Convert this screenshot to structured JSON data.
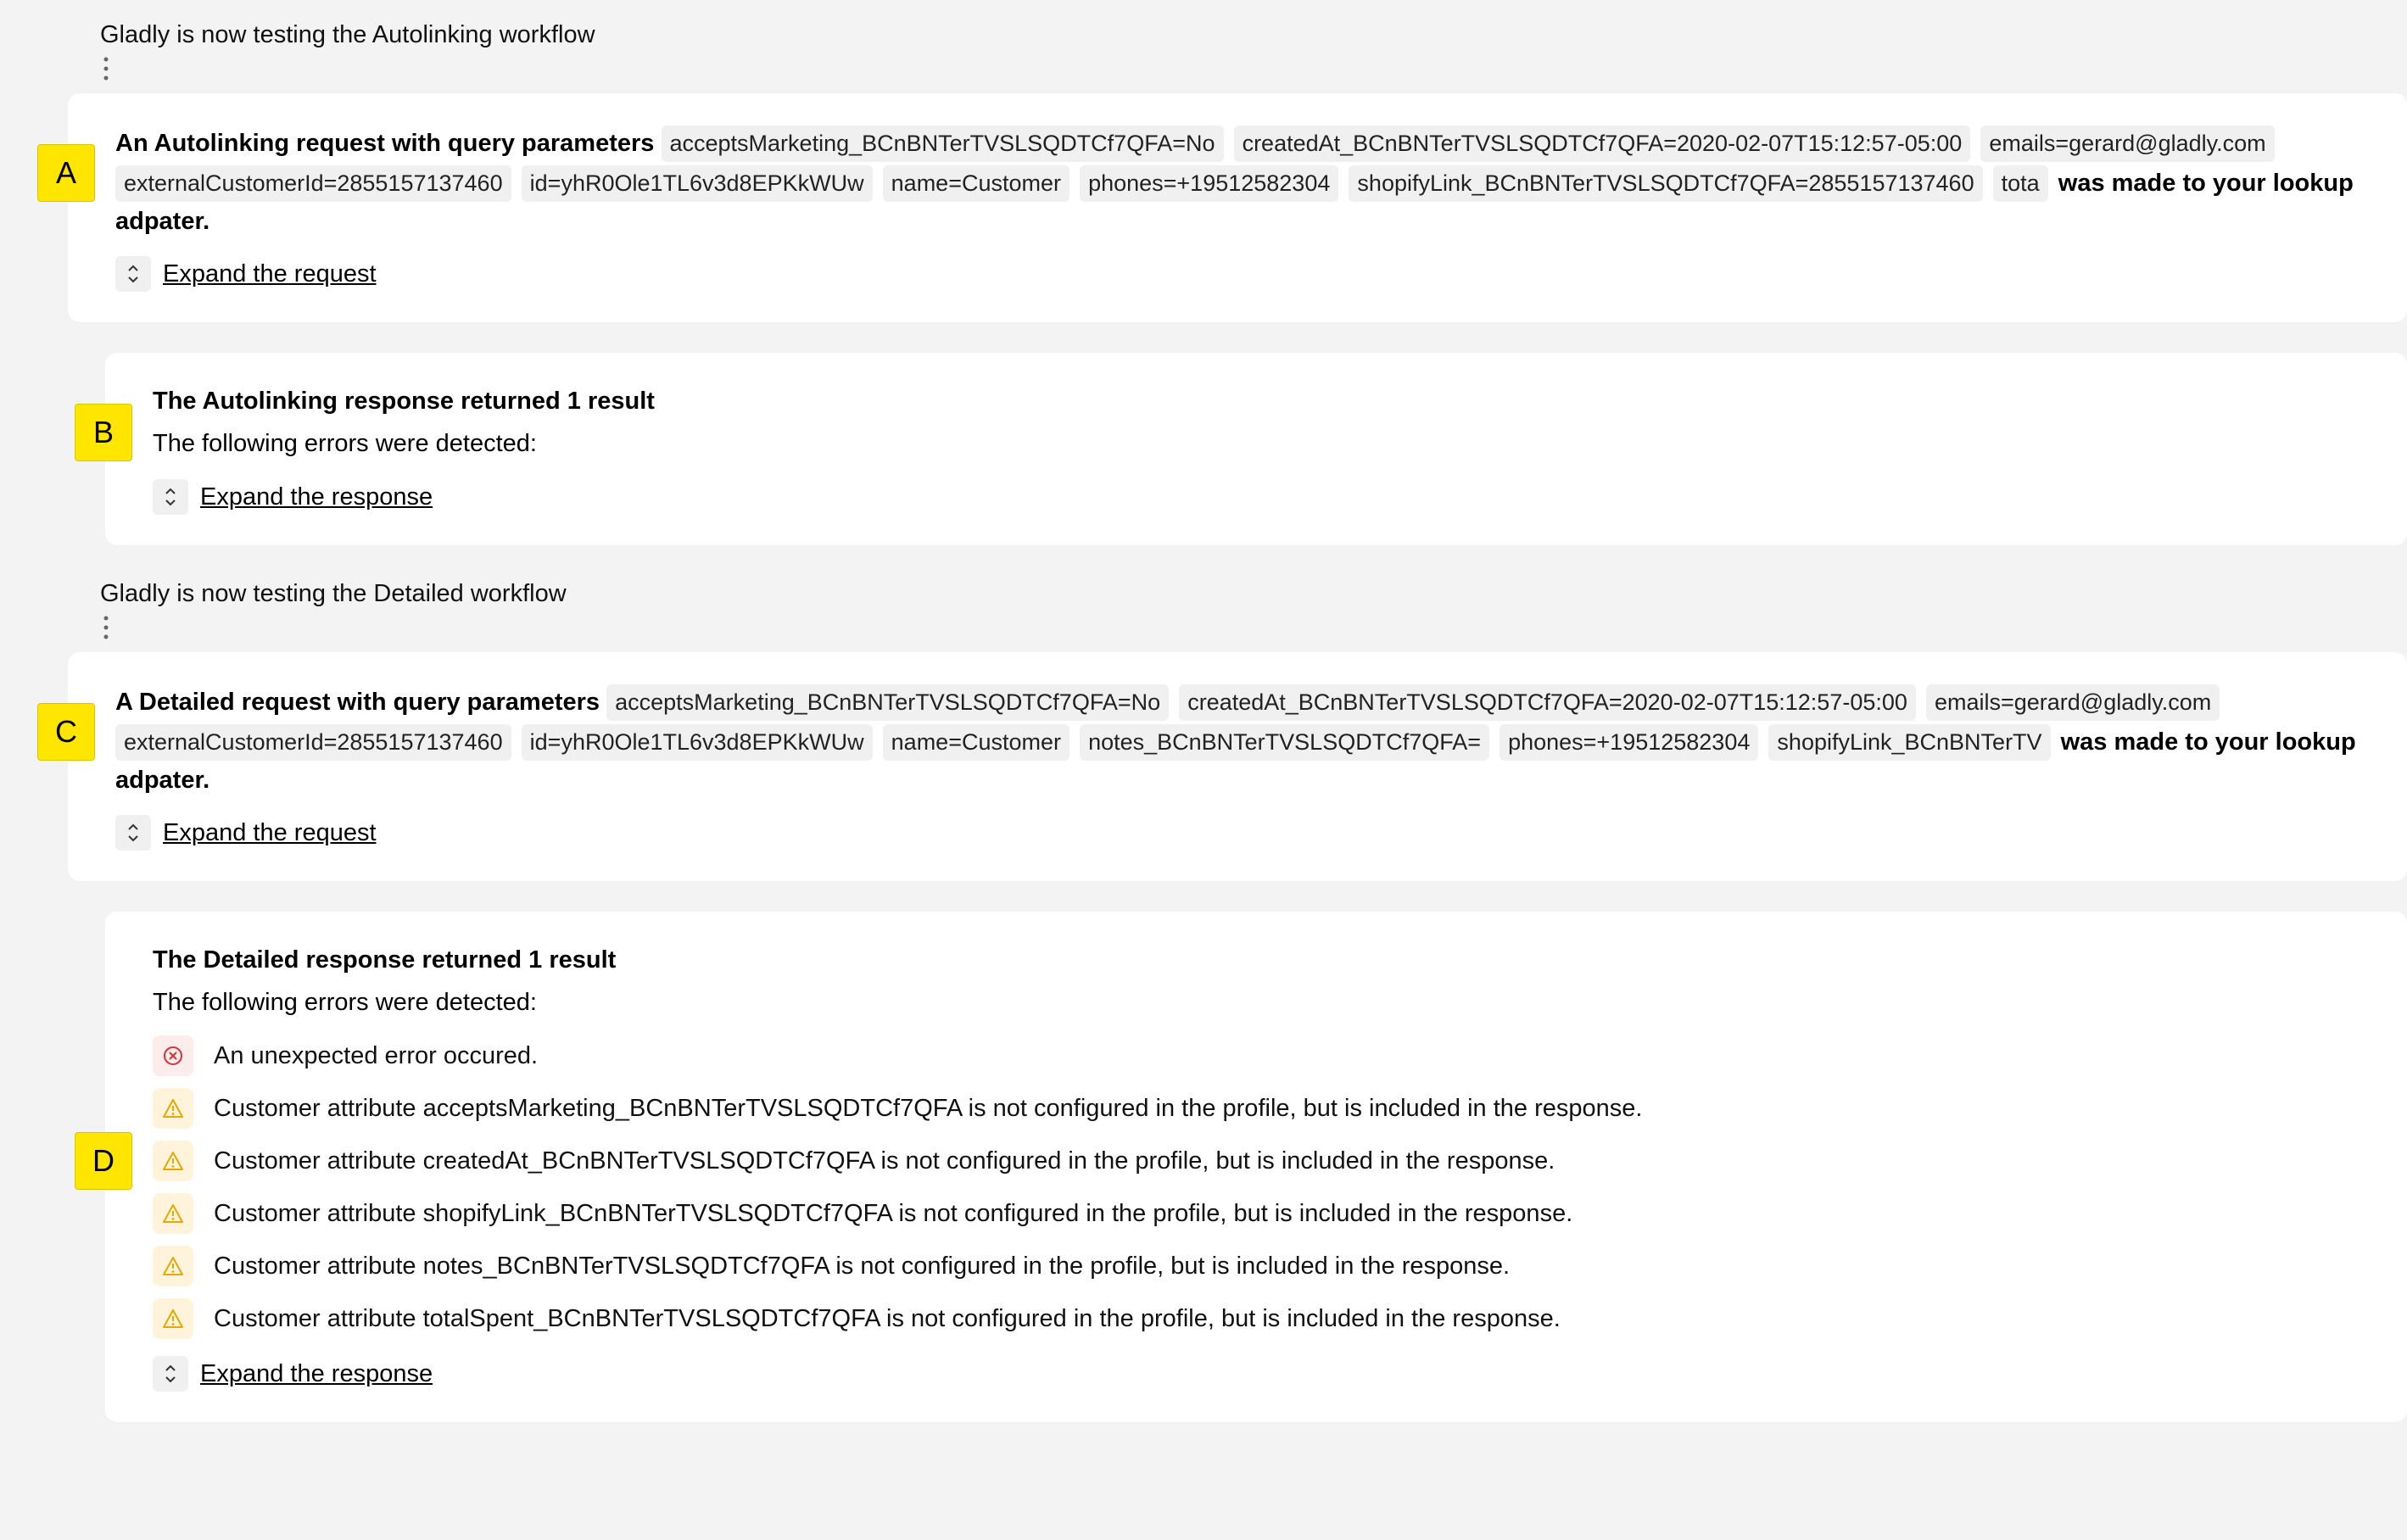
{
  "section1": {
    "label": "Gladly is now testing the Autolinking workflow"
  },
  "cardA": {
    "badge": "A",
    "lead": "An Autolinking request with query parameters",
    "chips": [
      "acceptsMarketing_BCnBNTerTVSLSQDTCf7QFA=No",
      "createdAt_BCnBNTerTVSLSQDTCf7QFA=2020-02-07T15:12:57-05:00",
      "emails=gerard@gladly.com",
      "externalCustomerId=2855157137460",
      "id=yhR0Ole1TL6v3d8EPKkWUw",
      "name=Customer",
      "phones=+19512582304",
      "shopifyLink_BCnBNTerTVSLSQDTCf7QFA=2855157137460",
      "tota"
    ],
    "trail": "was made to your lookup adpater.",
    "expand": "Expand the request"
  },
  "cardB": {
    "badge": "B",
    "title": "The Autolinking response returned 1 result",
    "sub": "The following errors were detected:",
    "expand": "Expand the response"
  },
  "section2": {
    "label": "Gladly is now testing the Detailed workflow"
  },
  "cardC": {
    "badge": "C",
    "lead": "A Detailed request with query parameters",
    "chips": [
      "acceptsMarketing_BCnBNTerTVSLSQDTCf7QFA=No",
      "createdAt_BCnBNTerTVSLSQDTCf7QFA=2020-02-07T15:12:57-05:00",
      "emails=gerard@gladly.com",
      "externalCustomerId=2855157137460",
      "id=yhR0Ole1TL6v3d8EPKkWUw",
      "name=Customer",
      "notes_BCnBNTerTVSLSQDTCf7QFA=",
      "phones=+19512582304",
      "shopifyLink_BCnBNTerTV"
    ],
    "trail": "was made to your lookup adpater.",
    "expand": "Expand the request"
  },
  "cardD": {
    "badge": "D",
    "title": "The Detailed response returned 1 result",
    "sub": "The following errors were detected:",
    "errors": [
      {
        "type": "err",
        "msg": "An unexpected error occured."
      },
      {
        "type": "warn",
        "msg": "Customer attribute acceptsMarketing_BCnBNTerTVSLSQDTCf7QFA is not configured in the profile, but is included in the response."
      },
      {
        "type": "warn",
        "msg": "Customer attribute createdAt_BCnBNTerTVSLSQDTCf7QFA is not configured in the profile, but is included in the response."
      },
      {
        "type": "warn",
        "msg": "Customer attribute shopifyLink_BCnBNTerTVSLSQDTCf7QFA is not configured in the profile, but is included in the response."
      },
      {
        "type": "warn",
        "msg": "Customer attribute notes_BCnBNTerTVSLSQDTCf7QFA is not configured in the profile, but is included in the response."
      },
      {
        "type": "warn",
        "msg": "Customer attribute totalSpent_BCnBNTerTVSLSQDTCf7QFA is not configured in the profile, but is included in the response."
      }
    ],
    "expand": "Expand the response"
  }
}
